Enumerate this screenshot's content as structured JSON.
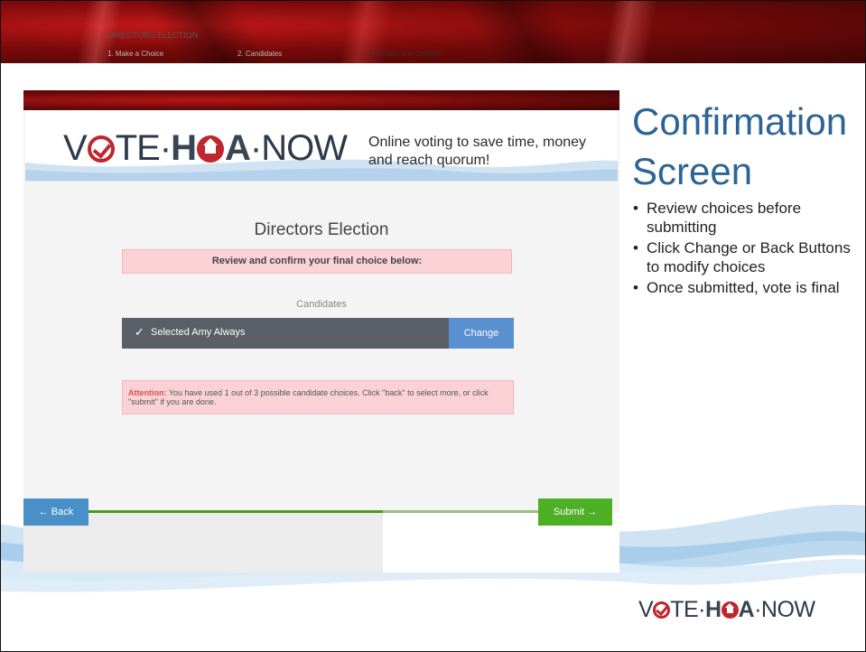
{
  "slide": {
    "title": "Confirmation Screen",
    "bullets": [
      "Review choices before submitting",
      "Click Change or Back Buttons to modify choices",
      "Once submitted, vote is final"
    ]
  },
  "header": {
    "logo_part1": "V",
    "logo_part2": "TE·",
    "logo_part3": "H",
    "logo_part4": "A",
    "logo_part5": "·NOW",
    "tagline": "Online voting to save time, money and reach quorum!"
  },
  "election": {
    "title": "Directors Election",
    "review_notice": "Review and confirm your final choice below:",
    "candidates_label": "Candidates",
    "selected_candidate": "Selected Amy Always",
    "change_label": "Change",
    "attention_label": "Attention:",
    "attention_text": "You have used 1 out of 3 possible candidate choices. Click \"back\" to select more, or click \"submit\" if you are done."
  },
  "nav": {
    "back_label": "← Back",
    "submit_label": "Submit →",
    "steps_heading": "DIRECTORS ELECTION",
    "steps": [
      "1. Make a Choice",
      "2. Candidates",
      "3. Review and Confirm"
    ]
  },
  "colors": {
    "accent_blue": "#2d6496",
    "brand_red": "#c0262d",
    "submit_green": "#4caf24",
    "button_blue": "#5a8fd0",
    "alert_pink": "#fad2d6"
  },
  "icons": [
    "check-icon",
    "arrow-left-icon",
    "arrow-right-icon",
    "checkmark-o-icon",
    "house-o-icon"
  ]
}
